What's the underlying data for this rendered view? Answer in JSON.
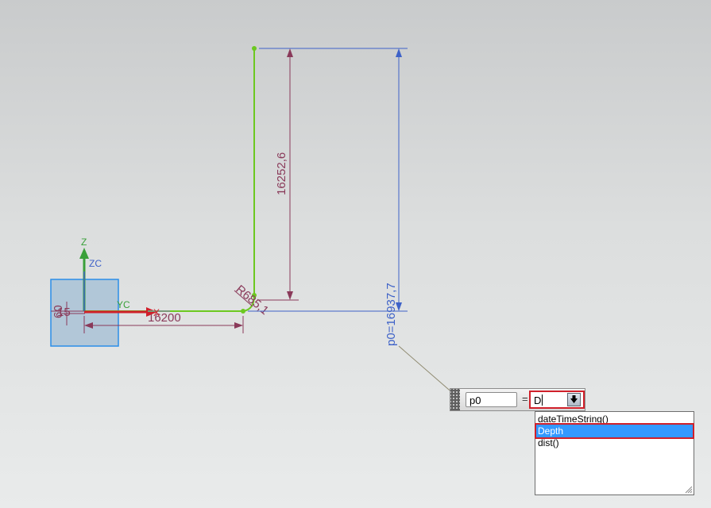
{
  "sketch": {
    "vertical_dimension": "16252,6",
    "horizontal_dimension": "16200",
    "radius_dimension": "R685,1",
    "parameter_dimension": "p0=16937,7",
    "small_dimension_1": "60",
    "small_dimension_2": "15"
  },
  "triad": {
    "z_label": "Z",
    "zc_label": "ZC",
    "yc_label": "YC",
    "x_label": "X"
  },
  "expression_editor": {
    "name_value": "p0",
    "equals_sign": "=",
    "value": "D"
  },
  "autocomplete": {
    "items": [
      {
        "label": "dateTimeString()"
      },
      {
        "label": "Depth"
      },
      {
        "label": "dist()"
      }
    ],
    "selected_index": 1
  },
  "colors": {
    "sketch_line": "#6cc820",
    "dimension_maroon": "#8a3a5a",
    "dimension_blue": "#3e62c8",
    "highlight_red": "#d0202a",
    "selection_blue": "#3399ff",
    "solid_box_fill": "#a9c2d6",
    "solid_box_edge": "#2a8ee8"
  },
  "icons": {
    "dropdown": "arrow-down-icon",
    "grip": "drag-grip-icon",
    "resize": "resize-grip-icon"
  }
}
